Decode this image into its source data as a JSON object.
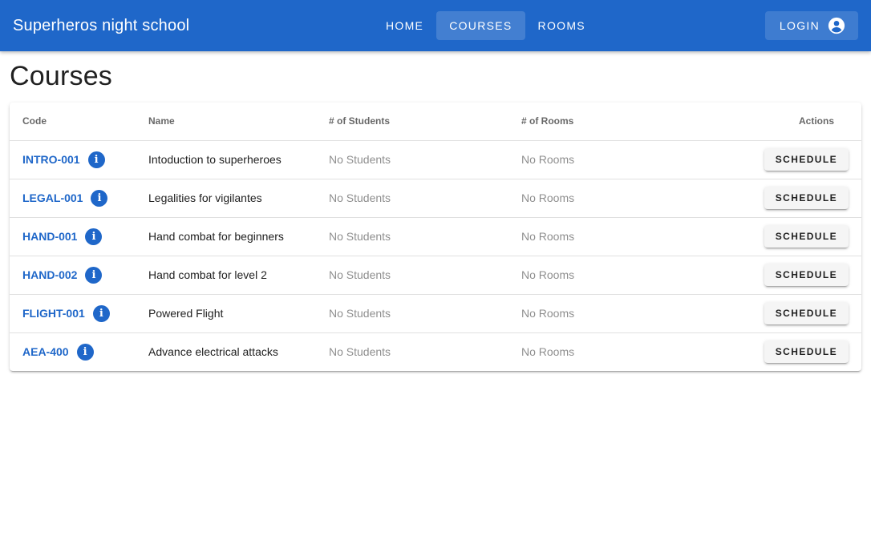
{
  "app": {
    "title": "Superheros night school",
    "brand_color": "#1f67c9"
  },
  "nav": {
    "items": [
      {
        "label": "HOME",
        "active": false
      },
      {
        "label": "COURSES",
        "active": true
      },
      {
        "label": "ROOMS",
        "active": false
      }
    ],
    "login_label": "LOGIN",
    "login_icon": "account-circle-icon"
  },
  "page": {
    "title": "Courses"
  },
  "table": {
    "headers": {
      "code": "Code",
      "name": "Name",
      "students": "# of Students",
      "rooms": "# of Rooms",
      "actions": "Actions"
    },
    "rows": [
      {
        "code": "INTRO-001",
        "name": "Intoduction to superheroes",
        "students": "No Students",
        "rooms": "No Rooms",
        "action": "SCHEDULE"
      },
      {
        "code": "LEGAL-001",
        "name": "Legalities for vigilantes",
        "students": "No Students",
        "rooms": "No Rooms",
        "action": "SCHEDULE"
      },
      {
        "code": "HAND-001",
        "name": "Hand combat for beginners",
        "students": "No Students",
        "rooms": "No Rooms",
        "action": "SCHEDULE"
      },
      {
        "code": "HAND-002",
        "name": "Hand combat for level 2",
        "students": "No Students",
        "rooms": "No Rooms",
        "action": "SCHEDULE"
      },
      {
        "code": "FLIGHT-001",
        "name": "Powered Flight",
        "students": "No Students",
        "rooms": "No Rooms",
        "action": "SCHEDULE"
      },
      {
        "code": "AEA-400",
        "name": "Advance electrical attacks",
        "students": "No Students",
        "rooms": "No Rooms",
        "action": "SCHEDULE"
      }
    ],
    "info_icon": "info-icon"
  }
}
